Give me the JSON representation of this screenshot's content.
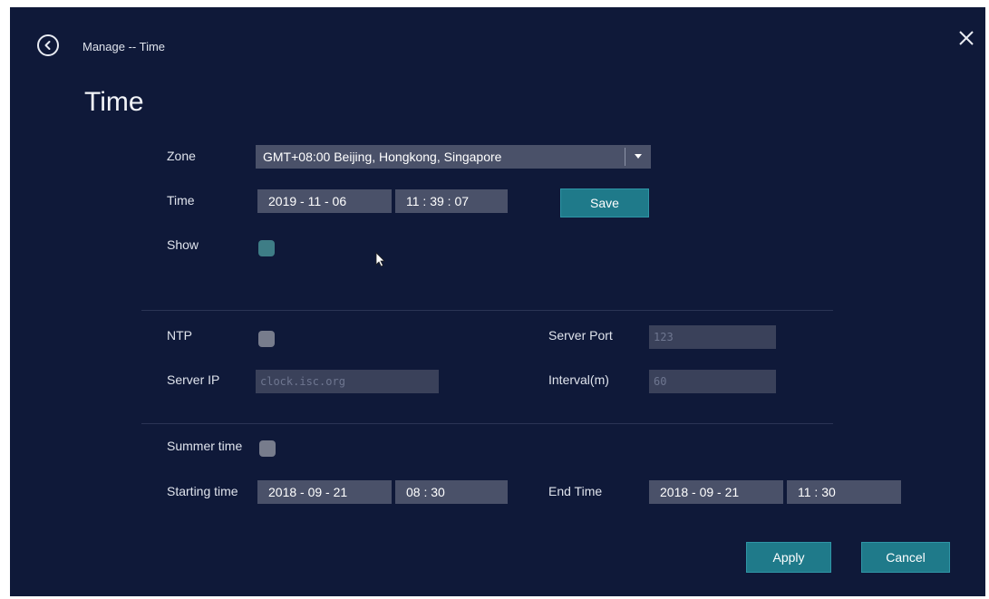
{
  "header": {
    "breadcrumb": "Manage -- Time",
    "title": "Time"
  },
  "form": {
    "zone": {
      "label": "Zone",
      "value": "GMT+08:00 Beijing, Hongkong, Singapore"
    },
    "time": {
      "label": "Time",
      "date": "2019 - 11 - 06",
      "clock": "11 : 39 : 07",
      "save_label": "Save"
    },
    "show": {
      "label": "Show",
      "checked": true
    },
    "ntp": {
      "label": "NTP",
      "checked": false
    },
    "server_ip": {
      "label": "Server IP",
      "value": "clock.isc.org"
    },
    "server_port": {
      "label": "Server Port",
      "value": "123"
    },
    "interval": {
      "label": "Interval(m)",
      "value": "60"
    },
    "summer_time": {
      "label": "Summer time",
      "checked": false
    },
    "starting_time": {
      "label": "Starting time",
      "date": "2018 - 09 - 21",
      "clock": "08 : 30"
    },
    "end_time": {
      "label": "End Time",
      "date": "2018 - 09 - 21",
      "clock": "11 : 30"
    }
  },
  "footer": {
    "apply_label": "Apply",
    "cancel_label": "Cancel"
  },
  "colors": {
    "background": "#0f1939",
    "field": "#4a5169",
    "accent": "#1f7a8a"
  },
  "icons": [
    "back-icon",
    "close-icon",
    "dropdown-caret-icon",
    "mouse-pointer-icon"
  ]
}
